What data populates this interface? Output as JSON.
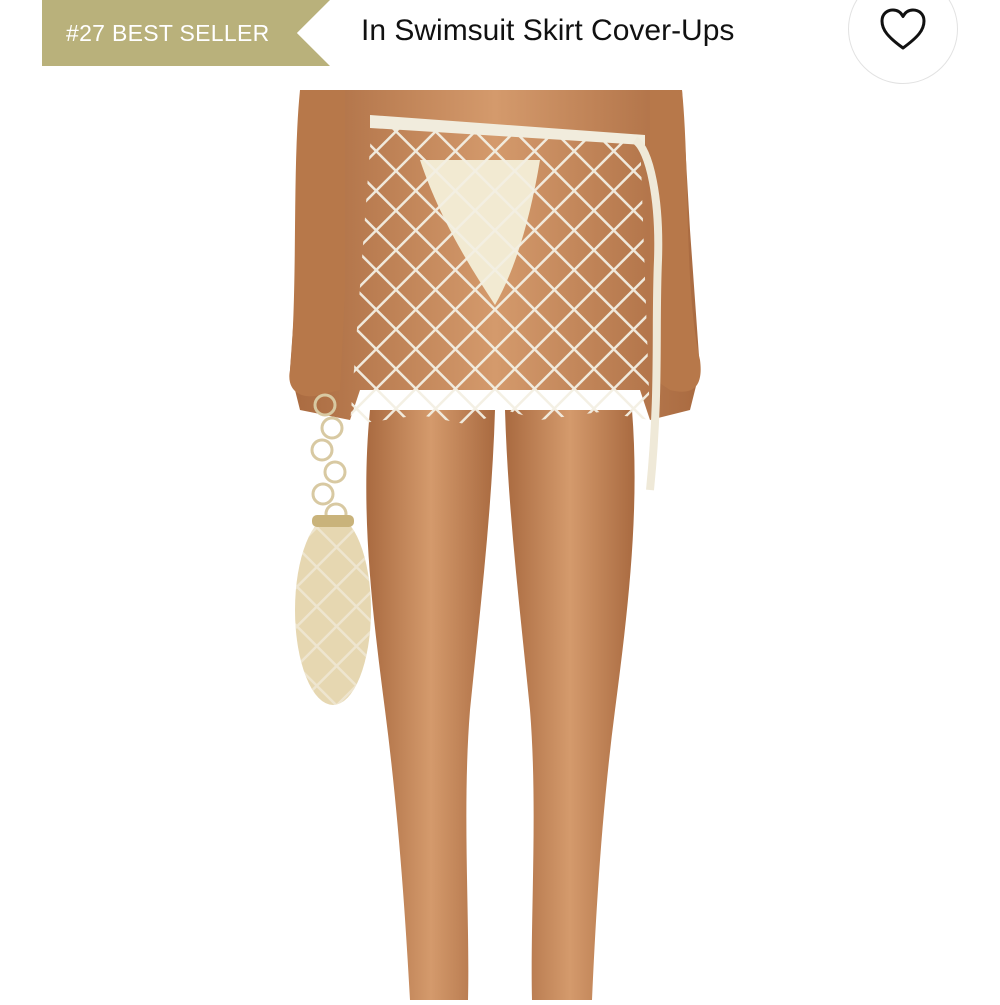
{
  "header": {
    "badge_text": "#27 BEST SELLER",
    "category_text": "In Swimsuit Skirt Cover-Ups",
    "badge_color": "#b9b17b",
    "favorite_icon": "heart-icon"
  },
  "product_image": {
    "icon": "product-photo",
    "skin_color": "#c98b5c",
    "skirt_color": "#f1ecdd"
  }
}
